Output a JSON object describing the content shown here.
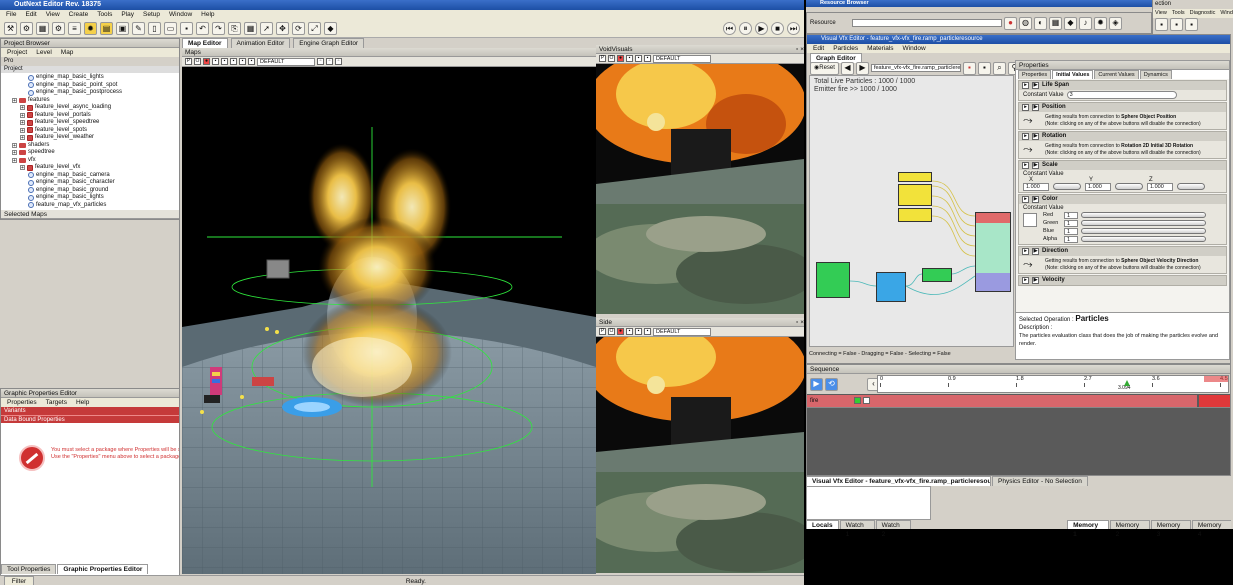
{
  "editor": {
    "title": "OutNext Editor Rev. 18375",
    "menu": [
      "File",
      "Edit",
      "View",
      "Create",
      "Tools",
      "Play",
      "Setup",
      "Window",
      "Help"
    ],
    "status": "Ready."
  },
  "project_browser": {
    "title": "Project Browser",
    "menu": [
      "Project",
      "Level",
      "Map"
    ],
    "search_label": "Pro",
    "root_label": "Project",
    "items": [
      {
        "label": "engine_map_basic_lights",
        "depth": 3,
        "kind": "map"
      },
      {
        "label": "engine_map_basic_point_spot",
        "depth": 3,
        "kind": "map"
      },
      {
        "label": "engine_map_basic_postprocess",
        "depth": 3,
        "kind": "map"
      },
      {
        "label": "features",
        "depth": 1,
        "kind": "folder"
      },
      {
        "label": "feature_level_async_loading",
        "depth": 2,
        "kind": "level"
      },
      {
        "label": "feature_level_portals",
        "depth": 2,
        "kind": "level"
      },
      {
        "label": "feature_level_speedtree",
        "depth": 2,
        "kind": "level"
      },
      {
        "label": "feature_level_spots",
        "depth": 2,
        "kind": "level"
      },
      {
        "label": "feature_level_weather",
        "depth": 2,
        "kind": "level"
      },
      {
        "label": "shaders",
        "depth": 1,
        "kind": "folder"
      },
      {
        "label": "speedtree",
        "depth": 1,
        "kind": "folder"
      },
      {
        "label": "vfx",
        "depth": 1,
        "kind": "folder"
      },
      {
        "label": "feature_level_vfx",
        "depth": 2,
        "kind": "level"
      },
      {
        "label": "engine_map_basic_camera",
        "depth": 3,
        "kind": "map"
      },
      {
        "label": "engine_map_basic_character",
        "depth": 3,
        "kind": "map"
      },
      {
        "label": "engine_map_basic_ground",
        "depth": 3,
        "kind": "map"
      },
      {
        "label": "engine_map_basic_lights",
        "depth": 3,
        "kind": "map"
      },
      {
        "label": "feature_map_vfx_particles",
        "depth": 3,
        "kind": "map"
      }
    ],
    "selected_maps_label": "Selected Maps"
  },
  "graphic_props": {
    "title": "Graphic Properties Editor",
    "menu": [
      "Properties",
      "Targets",
      "Help"
    ],
    "rows": [
      "Variants",
      "Data Bound Properties"
    ],
    "message_line1": "You must select a package where Properties will be stored.",
    "message_line2": "Use the \"Properties\" menu above to select a package or click th",
    "bottom_tabs": [
      "Tool Properties",
      "Graphic Properties Editor"
    ],
    "filter_label": "Filter"
  },
  "map_editor": {
    "tabs": [
      "Map Editor",
      "Animation Editor",
      "Engine Graph Editor"
    ],
    "sub_title": "Maps",
    "render_mode": "DEFAULT"
  },
  "viewports": [
    {
      "title": "VoidVisuals",
      "render_mode": "DEFAULT"
    },
    {
      "title": "Side",
      "render_mode": "DEFAULT"
    }
  ],
  "resource_browser": {
    "title": "Resource Browser",
    "label": "Resource"
  },
  "vfx_editor": {
    "title": "Visual Vfx Editor - feature_vfx-vfx_fire.ramp_particleresource",
    "menu": [
      "Edit",
      "Particles",
      "Materials",
      "Window"
    ],
    "tab": "Graph Editor",
    "reset_label": "Reset",
    "resource_field": "feature_vfx-vfx_fire.ramp_particleresource",
    "stat_live": "Total Live Particles : 1000 / 1000",
    "stat_emitter": "Emitter fire >> 1000 / 1000",
    "status_line": "Connecting = False - Dragging = False - Selecting = False",
    "bottom_tabs": [
      "Visual Vfx Editor - feature_vfx-vfx_fire.ramp_particleresource",
      "Physics Editor - No Selection"
    ]
  },
  "properties": {
    "title": "Properties",
    "tabs": [
      "Properties",
      "Initial Values",
      "Current Values",
      "Dynamics"
    ],
    "sections": [
      {
        "name": "Life Span",
        "kind": "const",
        "label": "Constant Value",
        "value": "3"
      },
      {
        "name": "Position",
        "kind": "link",
        "link_prefix": "Getting results from connection to",
        "link_target": "Sphere Object Position",
        "note": "(Note: clicking on any of the above buttons will disable the connection)"
      },
      {
        "name": "Rotation",
        "kind": "link",
        "link_prefix": "Getting results from connection to",
        "link_target": "Rotation 2D Initial 3D Rotation",
        "note": "(Note: clicking on any of the above buttons will disable the connection)"
      },
      {
        "name": "Scale",
        "kind": "vec3",
        "label": "Constant Value",
        "axes": [
          "X",
          "Y",
          "Z"
        ],
        "values": [
          "1.000",
          "1.000",
          "1.000"
        ]
      },
      {
        "name": "Color",
        "kind": "color",
        "label": "Constant Value",
        "channels": [
          {
            "name": "Red",
            "value": "1"
          },
          {
            "name": "Green",
            "value": "1"
          },
          {
            "name": "Blue",
            "value": "1"
          },
          {
            "name": "Alpha",
            "value": "1"
          }
        ]
      },
      {
        "name": "Direction",
        "kind": "link",
        "link_prefix": "Getting results from connection to",
        "link_target": "Sphere Object Velocity Direction",
        "note": "(Note: clicking on any of the above buttons will disable the connection)"
      },
      {
        "name": "Velocity",
        "kind": "header"
      }
    ],
    "selected_label": "Selected Operation :",
    "selected_value": "Particles",
    "description_label": "Description :",
    "description_text": "The particles evaluation class that does the job of making the particles evolve and render."
  },
  "sequence": {
    "title": "Sequence",
    "ticks": [
      "0",
      "0.9",
      "1.8",
      "2.7",
      "3.6",
      "4.5"
    ],
    "cursor_label": "3.094",
    "track_label": "fire"
  },
  "debug": {
    "tabs": [
      "Locals",
      "Watch 1",
      "Watch 2"
    ],
    "memory_tabs": [
      "Memory 1",
      "Memory 2",
      "Memory 3",
      "Memory 4"
    ]
  },
  "right_mini": {
    "menu": [
      "View",
      "Tools",
      "Diagnostic",
      "Window"
    ],
    "title": "ection"
  },
  "colors": {
    "node_yellow": "#f2e23a",
    "node_green": "#33cc55",
    "node_teal": "#2a8a7a",
    "node_blue": "#3aa6e6",
    "node_out": "#a8e6c8",
    "track_red": "#d8666b",
    "message_red": "#d03030"
  }
}
